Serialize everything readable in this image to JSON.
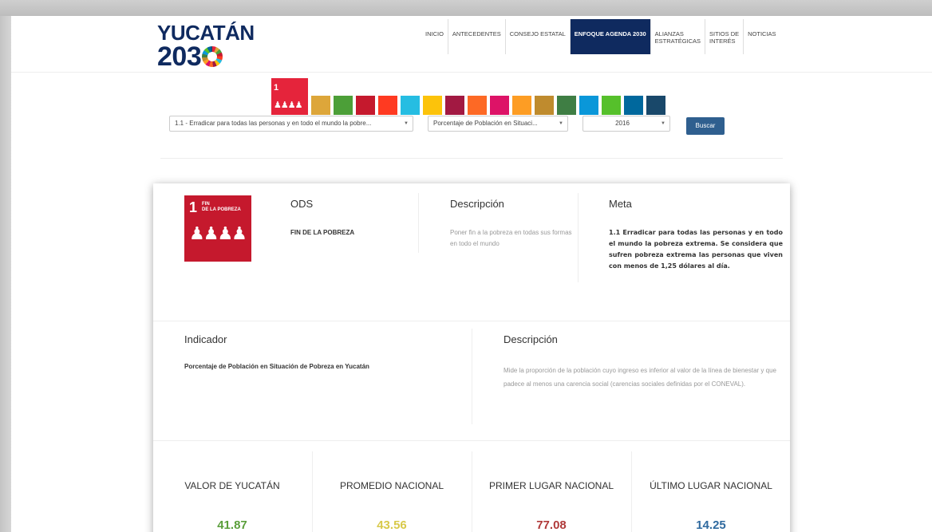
{
  "header": {
    "logo_top": "YUCATÁN",
    "logo_bottom": "203",
    "nav": [
      {
        "label": "INICIO"
      },
      {
        "label": "ANTECEDENTES"
      },
      {
        "label": "CONSEJO ESTATAL"
      },
      {
        "label": "ENFOQUE AGENDA 2030",
        "active": true
      },
      {
        "label": "ALIANZAS\nESTRATÉGICAS"
      },
      {
        "label": "SITIOS DE\nINTERÉS"
      },
      {
        "label": "NOTICIAS"
      }
    ]
  },
  "goals": {
    "selected_number": "1",
    "selected_label": "FIN DE LA POBREZA",
    "icon_colors": [
      "#dda63a",
      "#4c9f38",
      "#c5192d",
      "#ff3a21",
      "#26bde2",
      "#fcc30b",
      "#a21942",
      "#fd6925",
      "#dd1367",
      "#fd9d24",
      "#bf8b2e",
      "#3f7e44",
      "#0a97d9",
      "#56c02b",
      "#00689d",
      "#19486a"
    ]
  },
  "filters": {
    "meta_select": "1.1 - Erradicar para todas las personas y en todo el mundo la pobre...",
    "indicator_select": "Porcentaje de Población en Situaci...",
    "year_select": "2016",
    "search_button": "Buscar"
  },
  "card": {
    "tile_number": "1",
    "tile_label": "FIN\nDE LA POBREZA",
    "ods_heading": "ODS",
    "ods_value": "FIN DE LA POBREZA",
    "desc_heading": "Descripción",
    "desc_value": "Poner fin a la pobreza en todas sus formas en todo el mundo",
    "meta_heading": "Meta",
    "meta_value": "1.1 Erradicar para todas las personas y en todo el mundo la pobreza extrema. Se considera que sufren pobreza extrema las personas que viven con menos de 1,25 dólares al día.",
    "indicator_heading": "Indicador",
    "indicator_value": "Porcentaje de Población en Situación de Pobreza en Yucatán",
    "indicator_desc_heading": "Descripción",
    "indicator_desc_value": "Mide la proporción de la población cuyo ingreso es inferior al valor de la línea de bienestar y que padece al menos una carencia social (carencias sociales definidas por el CONEVAL).",
    "stats": [
      {
        "label": "VALOR DE YUCATÁN",
        "value": "41.87",
        "color": "#5a9e3a"
      },
      {
        "label": "PROMEDIO NACIONAL",
        "value": "43.56",
        "color": "#d8c94a"
      },
      {
        "label": "PRIMER LUGAR NACIONAL",
        "value": "77.08",
        "color": "#b03a3a"
      },
      {
        "label": "ÚLTIMO LUGAR NACIONAL",
        "value": "14.25",
        "color": "#2f6a9f"
      }
    ]
  },
  "colors": {
    "brand_navy": "#0f2a5f",
    "goal1_red": "#e5243b",
    "button_blue": "#2f5f8f"
  }
}
